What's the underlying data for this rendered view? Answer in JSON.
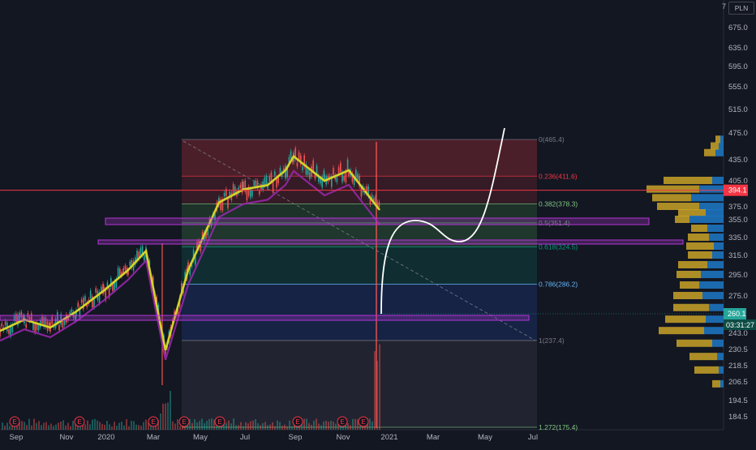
{
  "header": {
    "currency": "PLN",
    "corner_glyph": "7"
  },
  "colors": {
    "background": "#131722",
    "grid": "#1e222d",
    "price_line": "#f23645",
    "last_price": "#26a69a",
    "sma_yellow": "#d4d42a",
    "sma_magenta": "#9c27b0",
    "projection": "#ffffff",
    "vp_up": "#1e73be",
    "vp_down": "#c9a227",
    "rect_purple": "#b535d6"
  },
  "chart_data": {
    "type": "line",
    "title": "",
    "ylim": [
      175,
      700
    ],
    "y_ticks": [
      "675.0",
      "635.0",
      "595.0",
      "555.0",
      "515.0",
      "475.0",
      "435.0",
      "405.0",
      "375.0",
      "355.0",
      "335.0",
      "315.0",
      "295.0",
      "275.0",
      "260.1",
      "243.0",
      "230.5",
      "218.5",
      "206.5",
      "194.5",
      "184.5"
    ],
    "x_labels": [
      "Sep",
      "Nov",
      "2020",
      "Mar",
      "May",
      "Jul",
      "Sep",
      "Nov",
      "2021",
      "Mar",
      "May",
      "Jul"
    ],
    "price_series": {
      "name": "",
      "x": [
        "2019-08",
        "2019-09",
        "2019-10",
        "2019-11",
        "2019-12",
        "2020-01",
        "2020-02",
        "2020-03",
        "2020-04",
        "2020-05",
        "2020-06",
        "2020-07",
        "2020-08",
        "2020-09",
        "2020-10",
        "2020-11",
        "2020-12"
      ],
      "values": [
        245,
        255,
        248,
        262,
        280,
        300,
        320,
        230,
        300,
        380,
        395,
        400,
        420,
        440,
        405,
        420,
        370
      ]
    },
    "fib_levels": [
      {
        "ratio": "0",
        "label": "0(465.4)",
        "value": 465.4,
        "color": "#787b86"
      },
      {
        "ratio": "0.236",
        "label": "0.236(411.6)",
        "value": 411.6,
        "color": "#f23645"
      },
      {
        "ratio": "0.382",
        "label": "0.382(378.3)",
        "value": 378.3,
        "color": "#81c784"
      },
      {
        "ratio": "0.5",
        "label": "0.5(351.4)",
        "value": 351.4,
        "color": "#4caf50"
      },
      {
        "ratio": "0.618",
        "label": "0.618(324.5)",
        "value": 324.5,
        "color": "#089981"
      },
      {
        "ratio": "0.786",
        "label": "0.786(286.2)",
        "value": 286.2,
        "color": "#64b5f6"
      },
      {
        "ratio": "1",
        "label": "1(237.4)",
        "value": 237.4,
        "color": "#787b86"
      },
      {
        "ratio": "1.272",
        "label": "1.272(175.4)",
        "value": 175.4,
        "color": "#81c784"
      }
    ],
    "horizontal_line": {
      "value": 394.1,
      "label": "394.1",
      "color": "#f23645"
    },
    "last_price": {
      "value": 260.1,
      "label": "260.1",
      "countdown": "03:31:27"
    },
    "events": [
      "E",
      "E",
      "E",
      "E",
      "E",
      "E",
      "E",
      "E"
    ],
    "grid": true,
    "legend": "none"
  }
}
